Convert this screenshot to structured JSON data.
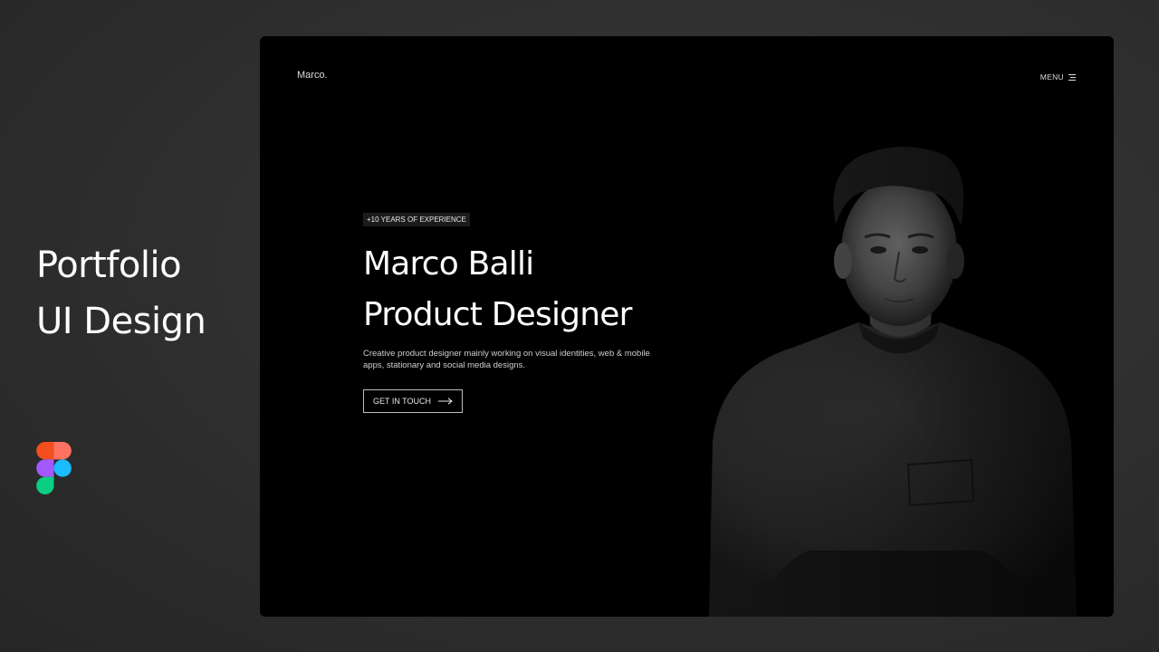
{
  "side": {
    "title_line1": "Portfolio",
    "title_line2": "UI Design"
  },
  "site": {
    "brand": "Marco.",
    "menu_label": "MENU"
  },
  "hero": {
    "badge": "+10 YEARS OF EXPERIENCE",
    "name": "Marco Balli",
    "role": "Product Designer",
    "description": "Creative product designer mainly working on visual identities, web & mobile apps, stationary and social media designs.",
    "cta_label": "GET IN TOUCH"
  },
  "icons": {
    "menu": "hamburger-icon",
    "cta_arrow": "arrow-right-icon",
    "app_logo": "figma-logo"
  },
  "colors": {
    "frame_bg": "#000000",
    "page_bg": "#2e2e2e",
    "text": "#ffffff",
    "figma_red": "#f24e1e",
    "figma_salmon": "#ff7262",
    "figma_purple": "#a259ff",
    "figma_blue": "#1abcfe",
    "figma_green": "#0acf83"
  }
}
